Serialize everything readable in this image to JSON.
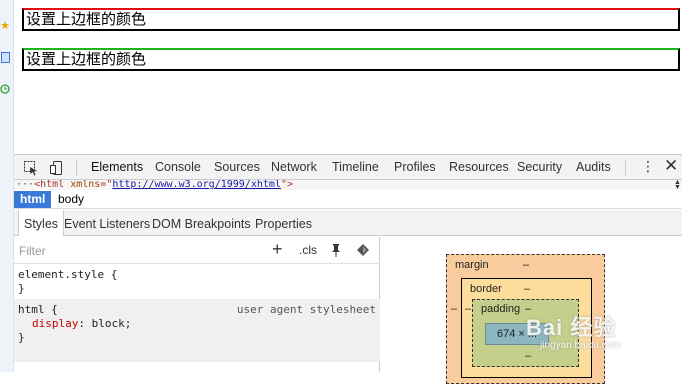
{
  "page": {
    "box1_text": "设置上边框的颜色",
    "box2_text": "设置上边框的颜色",
    "box1_top_color": "#e01010",
    "box2_top_color": "#18b818"
  },
  "sidebar_icons": [
    "star-icon",
    "bookmark-icon",
    "history-icon"
  ],
  "devtools": {
    "tabs": [
      "Elements",
      "Console",
      "Sources",
      "Network",
      "Timeline",
      "Profiles",
      "Resources",
      "Security",
      "Audits"
    ],
    "active_tab": "Elements",
    "menu_glyph": "⋮",
    "close_glyph": "✕",
    "source_line": {
      "tag_open": "<html ",
      "attr": "xmlns",
      "eq": "=\"",
      "value": "http://www.w3.org/1999/xhtml",
      "close": "\">"
    },
    "breadcrumbs": [
      "html",
      "body"
    ],
    "selected_crumb": "html",
    "sub_tabs": [
      "Styles",
      "Event Listeners",
      "DOM Breakpoints",
      "Properties"
    ],
    "active_sub_tab": "Styles",
    "filter_placeholder": "Filter",
    "filter_plus": "+",
    "filter_cls": ".cls",
    "rules": {
      "element_style_selector": "element.style {",
      "element_style_close": "}",
      "html_selector": "html {",
      "html_source": "user agent stylesheet",
      "html_prop": "display",
      "html_value": "block;",
      "html_close": "}"
    },
    "box_model": {
      "margin_label": "margin",
      "margin_value": "–",
      "border_label": "border",
      "border_value": "–",
      "padding_label": "padding",
      "padding_value": "–",
      "content_width": "674 × ...",
      "side_dash": "–"
    }
  },
  "watermark": {
    "text": "Bai 经验",
    "sub": "jingyan.baidu.com"
  }
}
